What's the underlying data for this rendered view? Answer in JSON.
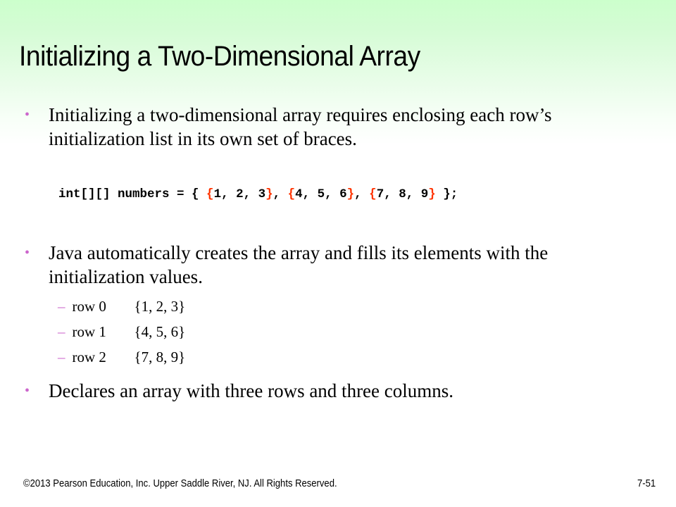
{
  "slide": {
    "title": "Initializing a Two-Dimensional Array",
    "bullets": [
      {
        "text": "Initializing a two-dimensional array requires enclosing each row’s initialization list in its own set of braces."
      },
      {
        "text": "Java automatically creates the array and fills its elements with the initialization values."
      },
      {
        "text": "Declares an array with three rows and three columns."
      }
    ],
    "code": {
      "prefix": "int[][] numbers = { ",
      "groups": [
        "1, 2, 3",
        "4, 5, 6",
        "7, 8, 9"
      ],
      "separator": ", ",
      "suffix": " };",
      "open_brace": "{",
      "close_brace": "}"
    },
    "sub_items": [
      {
        "label": "row 0",
        "value": "{1, 2, 3}"
      },
      {
        "label": "row 1",
        "value": "{4, 5, 6}"
      },
      {
        "label": "row 2",
        "value": "{7, 8, 9}"
      }
    ],
    "bullet_glyph": "•",
    "dash_glyph": "–"
  },
  "footer": {
    "copyright": "©2013 Pearson Education, Inc. Upper Saddle River, NJ. All Rights Reserved.",
    "page_number": "7-51"
  },
  "colors": {
    "background_top": "#ccffcc",
    "bullet": "#cc66cc",
    "code_brace": "#ff3300"
  }
}
